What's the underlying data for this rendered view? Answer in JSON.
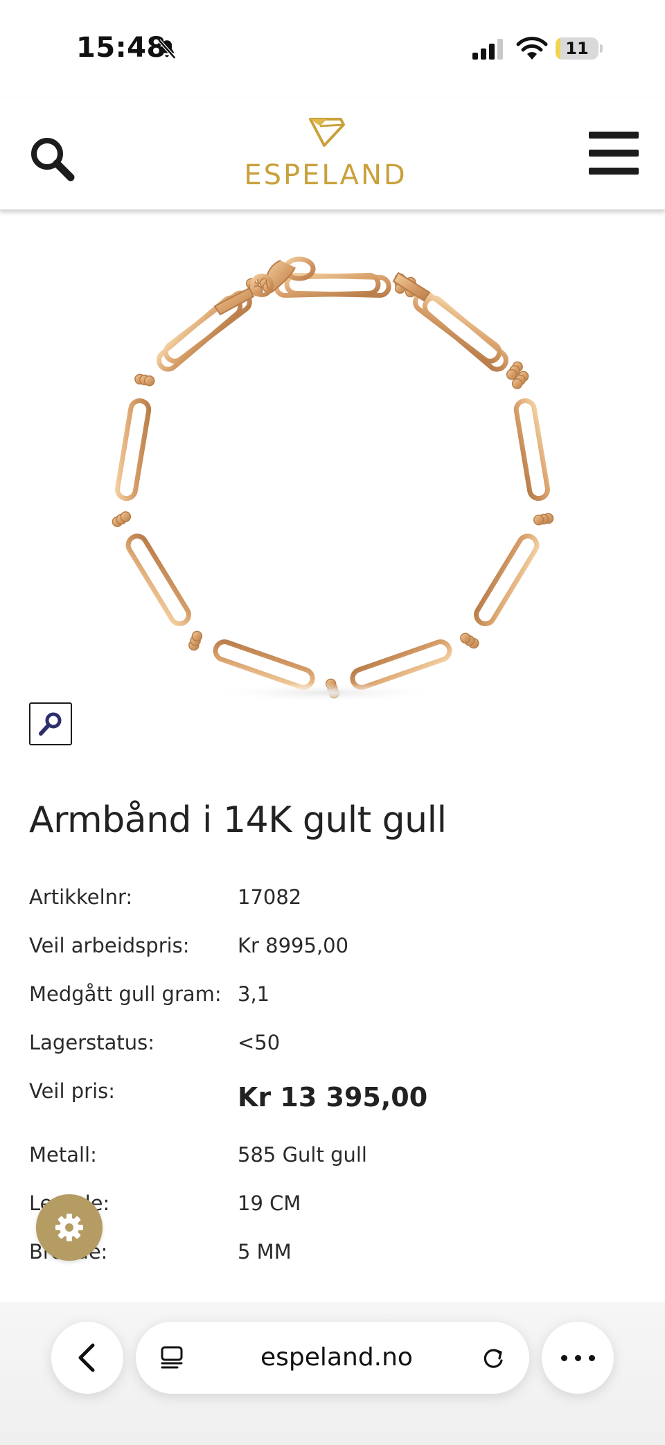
{
  "status_bar": {
    "time": "15:48",
    "battery": "11",
    "battery_level": 0.11,
    "icons": [
      "bell-slash-icon",
      "cellular-signal-icon",
      "wifi-icon",
      "battery-icon"
    ]
  },
  "header": {
    "logo_text": "ESPELAND",
    "brand_color": "#c9a13b",
    "icons": [
      "search-icon",
      "logo-diamond-icon",
      "hamburger-menu-icon"
    ]
  },
  "product": {
    "image_alt_name": "gold-link-bracelet",
    "zoom_icon": "magnifier-icon",
    "title": "Armbånd i 14K gult gull",
    "specs": [
      {
        "label": "Artikkelnr:",
        "value": "17082"
      },
      {
        "label": "Veil arbeidspris:",
        "value": "Kr 8995,00"
      },
      {
        "label": "Medgått gull gram:",
        "value": "3,1"
      },
      {
        "label": "Lagerstatus:",
        "value": "<50"
      },
      {
        "label": "Veil pris:",
        "value": "Kr 13 395,00"
      },
      {
        "label": "Metall:",
        "value": "585 Gult gull"
      },
      {
        "label": "Lengde:",
        "value": "19 CM"
      },
      {
        "label": "Bredde:",
        "value": "5 MM"
      }
    ]
  },
  "settings_fab": {
    "icon": "gear-icon",
    "color": "#b59c63"
  },
  "browser": {
    "url": "espeland.no",
    "icons": [
      "chevron-left-icon",
      "tabs-icon",
      "reload-icon",
      "more-icon"
    ]
  }
}
